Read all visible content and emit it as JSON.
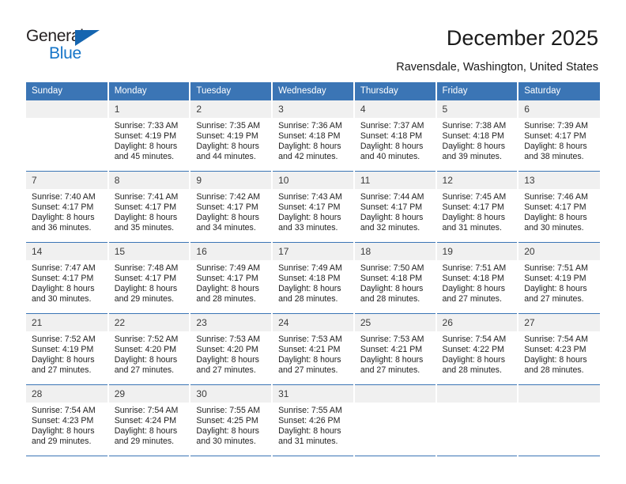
{
  "brand": {
    "name_top": "General",
    "name_bottom": "Blue",
    "triangle_color": "#1565b0",
    "text_color": "#231f20",
    "blue_color": "#1675c8"
  },
  "header": {
    "title": "December 2025",
    "location": "Ravensdale, Washington, United States"
  },
  "theme": {
    "header_bg": "#3b75b5",
    "header_text": "#ffffff",
    "daynum_bg": "#f0f0f0",
    "row_border": "#3b75b5"
  },
  "calendar": {
    "weekday_headers": [
      "Sunday",
      "Monday",
      "Tuesday",
      "Wednesday",
      "Thursday",
      "Friday",
      "Saturday"
    ],
    "weeks": [
      [
        {
          "day": "",
          "lines": []
        },
        {
          "day": "1",
          "lines": [
            "Sunrise: 7:33 AM",
            "Sunset: 4:19 PM",
            "Daylight: 8 hours",
            "and 45 minutes."
          ]
        },
        {
          "day": "2",
          "lines": [
            "Sunrise: 7:35 AM",
            "Sunset: 4:19 PM",
            "Daylight: 8 hours",
            "and 44 minutes."
          ]
        },
        {
          "day": "3",
          "lines": [
            "Sunrise: 7:36 AM",
            "Sunset: 4:18 PM",
            "Daylight: 8 hours",
            "and 42 minutes."
          ]
        },
        {
          "day": "4",
          "lines": [
            "Sunrise: 7:37 AM",
            "Sunset: 4:18 PM",
            "Daylight: 8 hours",
            "and 40 minutes."
          ]
        },
        {
          "day": "5",
          "lines": [
            "Sunrise: 7:38 AM",
            "Sunset: 4:18 PM",
            "Daylight: 8 hours",
            "and 39 minutes."
          ]
        },
        {
          "day": "6",
          "lines": [
            "Sunrise: 7:39 AM",
            "Sunset: 4:17 PM",
            "Daylight: 8 hours",
            "and 38 minutes."
          ]
        }
      ],
      [
        {
          "day": "7",
          "lines": [
            "Sunrise: 7:40 AM",
            "Sunset: 4:17 PM",
            "Daylight: 8 hours",
            "and 36 minutes."
          ]
        },
        {
          "day": "8",
          "lines": [
            "Sunrise: 7:41 AM",
            "Sunset: 4:17 PM",
            "Daylight: 8 hours",
            "and 35 minutes."
          ]
        },
        {
          "day": "9",
          "lines": [
            "Sunrise: 7:42 AM",
            "Sunset: 4:17 PM",
            "Daylight: 8 hours",
            "and 34 minutes."
          ]
        },
        {
          "day": "10",
          "lines": [
            "Sunrise: 7:43 AM",
            "Sunset: 4:17 PM",
            "Daylight: 8 hours",
            "and 33 minutes."
          ]
        },
        {
          "day": "11",
          "lines": [
            "Sunrise: 7:44 AM",
            "Sunset: 4:17 PM",
            "Daylight: 8 hours",
            "and 32 minutes."
          ]
        },
        {
          "day": "12",
          "lines": [
            "Sunrise: 7:45 AM",
            "Sunset: 4:17 PM",
            "Daylight: 8 hours",
            "and 31 minutes."
          ]
        },
        {
          "day": "13",
          "lines": [
            "Sunrise: 7:46 AM",
            "Sunset: 4:17 PM",
            "Daylight: 8 hours",
            "and 30 minutes."
          ]
        }
      ],
      [
        {
          "day": "14",
          "lines": [
            "Sunrise: 7:47 AM",
            "Sunset: 4:17 PM",
            "Daylight: 8 hours",
            "and 30 minutes."
          ]
        },
        {
          "day": "15",
          "lines": [
            "Sunrise: 7:48 AM",
            "Sunset: 4:17 PM",
            "Daylight: 8 hours",
            "and 29 minutes."
          ]
        },
        {
          "day": "16",
          "lines": [
            "Sunrise: 7:49 AM",
            "Sunset: 4:17 PM",
            "Daylight: 8 hours",
            "and 28 minutes."
          ]
        },
        {
          "day": "17",
          "lines": [
            "Sunrise: 7:49 AM",
            "Sunset: 4:18 PM",
            "Daylight: 8 hours",
            "and 28 minutes."
          ]
        },
        {
          "day": "18",
          "lines": [
            "Sunrise: 7:50 AM",
            "Sunset: 4:18 PM",
            "Daylight: 8 hours",
            "and 28 minutes."
          ]
        },
        {
          "day": "19",
          "lines": [
            "Sunrise: 7:51 AM",
            "Sunset: 4:18 PM",
            "Daylight: 8 hours",
            "and 27 minutes."
          ]
        },
        {
          "day": "20",
          "lines": [
            "Sunrise: 7:51 AM",
            "Sunset: 4:19 PM",
            "Daylight: 8 hours",
            "and 27 minutes."
          ]
        }
      ],
      [
        {
          "day": "21",
          "lines": [
            "Sunrise: 7:52 AM",
            "Sunset: 4:19 PM",
            "Daylight: 8 hours",
            "and 27 minutes."
          ]
        },
        {
          "day": "22",
          "lines": [
            "Sunrise: 7:52 AM",
            "Sunset: 4:20 PM",
            "Daylight: 8 hours",
            "and 27 minutes."
          ]
        },
        {
          "day": "23",
          "lines": [
            "Sunrise: 7:53 AM",
            "Sunset: 4:20 PM",
            "Daylight: 8 hours",
            "and 27 minutes."
          ]
        },
        {
          "day": "24",
          "lines": [
            "Sunrise: 7:53 AM",
            "Sunset: 4:21 PM",
            "Daylight: 8 hours",
            "and 27 minutes."
          ]
        },
        {
          "day": "25",
          "lines": [
            "Sunrise: 7:53 AM",
            "Sunset: 4:21 PM",
            "Daylight: 8 hours",
            "and 27 minutes."
          ]
        },
        {
          "day": "26",
          "lines": [
            "Sunrise: 7:54 AM",
            "Sunset: 4:22 PM",
            "Daylight: 8 hours",
            "and 28 minutes."
          ]
        },
        {
          "day": "27",
          "lines": [
            "Sunrise: 7:54 AM",
            "Sunset: 4:23 PM",
            "Daylight: 8 hours",
            "and 28 minutes."
          ]
        }
      ],
      [
        {
          "day": "28",
          "lines": [
            "Sunrise: 7:54 AM",
            "Sunset: 4:23 PM",
            "Daylight: 8 hours",
            "and 29 minutes."
          ]
        },
        {
          "day": "29",
          "lines": [
            "Sunrise: 7:54 AM",
            "Sunset: 4:24 PM",
            "Daylight: 8 hours",
            "and 29 minutes."
          ]
        },
        {
          "day": "30",
          "lines": [
            "Sunrise: 7:55 AM",
            "Sunset: 4:25 PM",
            "Daylight: 8 hours",
            "and 30 minutes."
          ]
        },
        {
          "day": "31",
          "lines": [
            "Sunrise: 7:55 AM",
            "Sunset: 4:26 PM",
            "Daylight: 8 hours",
            "and 31 minutes."
          ]
        },
        {
          "day": "",
          "lines": []
        },
        {
          "day": "",
          "lines": []
        },
        {
          "day": "",
          "lines": []
        }
      ]
    ]
  }
}
